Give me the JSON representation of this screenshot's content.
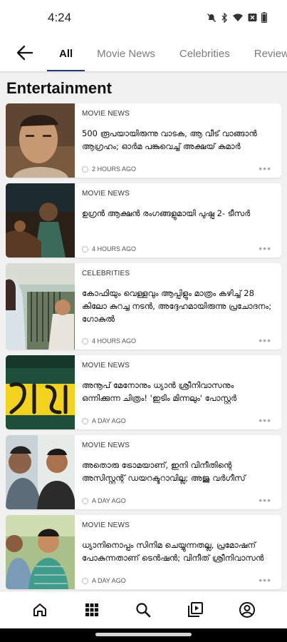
{
  "status_bar": {
    "time": "4:24",
    "icons": [
      "bell-off-icon",
      "bluetooth-icon",
      "wifi-icon",
      "notification-box-icon",
      "battery-icon"
    ]
  },
  "nav": {
    "back_icon": "arrow-left-icon",
    "tabs": [
      {
        "label": "All",
        "active": true
      },
      {
        "label": "Movie News",
        "active": false
      },
      {
        "label": "Celebrities",
        "active": false
      },
      {
        "label": "Reviews",
        "active": false
      }
    ]
  },
  "section": {
    "title": "Entertainment"
  },
  "articles": [
    {
      "category": "MOVIE NEWS",
      "headline": "500 രൂപയായിരുന്നു വാടക, ആ വീട് വാങ്ങാൻ ആഗ്രഹം; ഓർമ പങ്കുവെച്ച് അക്ഷയ് കുമാർ",
      "time": "2 HOURS AGO"
    },
    {
      "category": "MOVIE NEWS",
      "headline": "ഉഗ്രൻ ആക്ഷൻ രംഗങ്ങളുമായി പുഷ്പ 2- ടീസർ",
      "time": "4 HOURS AGO"
    },
    {
      "category": "CELEBRITIES",
      "headline": "കോഫിയും വെള്ളവും ആപ്പിളും മാത്രം കഴിച്ച് 28 കിലോ കുറച്ച നടൻ, അദ്ദേഹമായിരുന്നു പ്രചോദനം; ഗോകുൽ",
      "time": "4 HOURS AGO"
    },
    {
      "category": "MOVIE NEWS",
      "headline": "അനൂപ് മേനോനും ധ്യാൻ ശ്രീനിവാസനും ഒന്നിക്കുന്ന ചിത്രം! 'ഇടിം മിന്നലും' പോസ്റ്റർ",
      "time": "A DAY AGO"
    },
    {
      "category": "MOVIE NEWS",
      "headline": "അതൊരു ട്രോമയാണ്, ഇനി വിനീതിന്റെ അസിസ്റ്റന്റ് ഡയറക്ടറാവില്ല; അജു വർഗീസ്",
      "time": "A DAY AGO"
    },
    {
      "category": "MOVIE NEWS",
      "headline": "ധ്യാനിനൊപ്പം സിനിമ ചെയ്യുന്നതല്ല, പ്രമോഷന് പോകുന്നതാണ് ടെൻഷൻ; വിനീത് ശ്രീനിവാസൻ",
      "time": "A DAY AGO"
    }
  ],
  "bottom_nav": [
    {
      "icon": "home-icon"
    },
    {
      "icon": "grid-icon"
    },
    {
      "icon": "search-icon"
    },
    {
      "icon": "video-library-icon"
    },
    {
      "icon": "account-icon"
    }
  ],
  "colors": {
    "accent": "#253b6e",
    "background": "#f1f1f1",
    "card": "#ffffff"
  }
}
